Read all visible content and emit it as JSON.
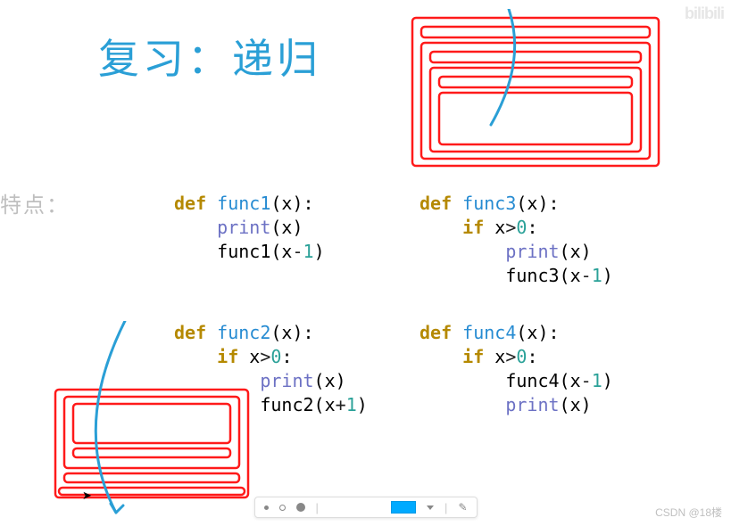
{
  "title": "复习：递归",
  "label_features": "特点：",
  "code": {
    "func1": {
      "def": "def",
      "name": "func1",
      "params": "(x):",
      "body1_call": "print",
      "body1_arg": "(x)",
      "body2_call": "func1",
      "body2_arg_open": "(x",
      "body2_op": "-",
      "body2_num": "1",
      "body2_close": ")"
    },
    "func2": {
      "def": "def",
      "name": "func2",
      "params": "(x):",
      "if_kw": "if",
      "if_cond_left": " x",
      "if_cond_op": ">",
      "if_cond_right": "0",
      "if_colon": ":",
      "body1_call": "print",
      "body1_arg": "(x)",
      "body2_call": "func2",
      "body2_arg_open": "(x",
      "body2_op": "+",
      "body2_num": "1",
      "body2_close": ")"
    },
    "func3": {
      "def": "def",
      "name": "func3",
      "params": "(x):",
      "if_kw": "if",
      "if_cond_left": " x",
      "if_cond_op": ">",
      "if_cond_right": "0",
      "if_colon": ":",
      "body1_call": "print",
      "body1_arg": "(x)",
      "body2_call": "func3",
      "body2_arg_open": "(x",
      "body2_op": "-",
      "body2_num": "1",
      "body2_close": ")"
    },
    "func4": {
      "def": "def",
      "name": "func4",
      "params": "(x):",
      "if_kw": "if",
      "if_cond_left": " x",
      "if_cond_op": ">",
      "if_cond_right": "0",
      "if_colon": ":",
      "body1_call": "func4",
      "body1_arg_open": "(x",
      "body1_op": "-",
      "body1_num": "1",
      "body1_close": ")",
      "body2_call": "print",
      "body2_arg": "(x)"
    }
  },
  "watermarks": {
    "bilibili": "bilibili",
    "csdn": "CSDN @18楼"
  },
  "toolbar": {
    "color": "#00aaff"
  }
}
